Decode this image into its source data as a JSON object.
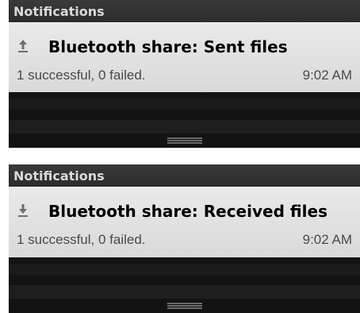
{
  "panels": [
    {
      "header": "Notifications",
      "title": "Bluetooth share: Sent files",
      "subtitle": "1 successful, 0 failed.",
      "time": "9:02 AM",
      "icon": "upload-arrow-icon"
    },
    {
      "header": "Notifications",
      "title": "Bluetooth share: Received files",
      "subtitle": "1 successful, 0 failed.",
      "time": "9:02 AM",
      "icon": "download-arrow-icon"
    }
  ],
  "colors": {
    "header_bg": "#333333",
    "card_bg": "#e0e0e0",
    "panel_bg": "#000000"
  }
}
